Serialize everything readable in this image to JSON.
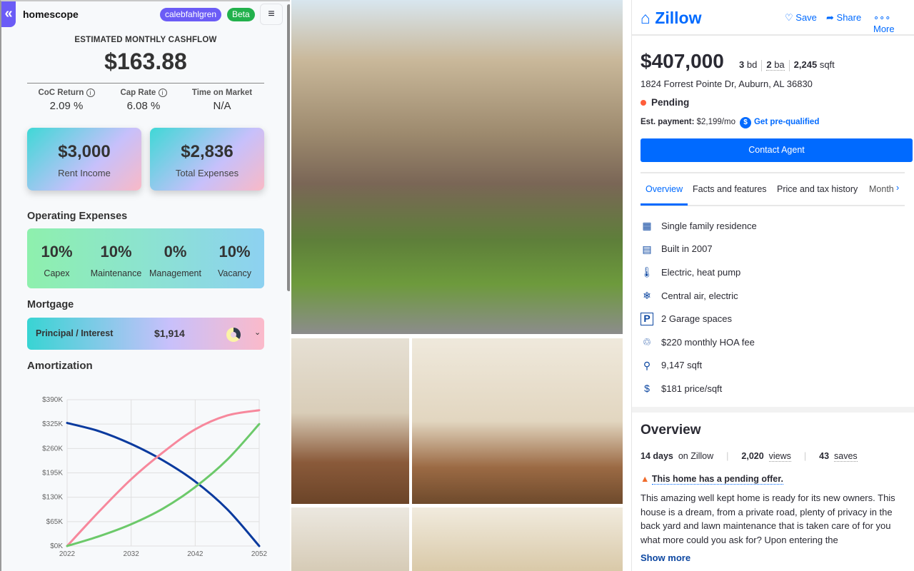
{
  "ext": {
    "brand": "homescope",
    "user": "calebfahlgren",
    "beta": "Beta",
    "cashflow_label": "ESTIMATED MONTHLY CASHFLOW",
    "cashflow": "$163.88",
    "stats": [
      {
        "label": "CoC Return",
        "value": "2.09 %",
        "info": true
      },
      {
        "label": "Cap Rate",
        "value": "6.08 %",
        "info": true
      },
      {
        "label": "Time on Market",
        "value": "N/A",
        "info": false
      }
    ],
    "cards": [
      {
        "value": "$3,000",
        "label": "Rent Income"
      },
      {
        "value": "$2,836",
        "label": "Total Expenses"
      }
    ],
    "opex_title": "Operating Expenses",
    "opex": [
      {
        "value": "10%",
        "label": "Capex"
      },
      {
        "value": "10%",
        "label": "Maintenance"
      },
      {
        "value": "0%",
        "label": "Management"
      },
      {
        "value": "10%",
        "label": "Vacancy"
      }
    ],
    "mortgage_title": "Mortgage",
    "mortgage_label": "Principal / Interest",
    "mortgage_value": "$1,914",
    "amort_title": "Amortization",
    "colors": {
      "accent": "#6b5cf6",
      "beta": "#22b14c"
    }
  },
  "chart_data": {
    "type": "line",
    "title": "",
    "xlabel": "",
    "ylabel": "",
    "x": [
      2022,
      2027,
      2032,
      2037,
      2042,
      2047,
      2052
    ],
    "xticks": [
      "2022",
      "2032",
      "2042",
      "2052"
    ],
    "yticks": [
      "$0K",
      "$65K",
      "$130K",
      "$195K",
      "$260K",
      "$325K",
      "$390K"
    ],
    "ylim": [
      0,
      390
    ],
    "grid": true,
    "series": [
      {
        "color": "#0a3a9e",
        "values": [
          328,
          306,
          272,
          228,
          172,
          98,
          0
        ]
      },
      {
        "color": "#f7889c",
        "values": [
          0,
          92,
          178,
          250,
          311,
          348,
          362
        ]
      },
      {
        "color": "#6cc96a",
        "values": [
          0,
          26,
          58,
          100,
          157,
          230,
          325
        ]
      }
    ]
  },
  "zillow": {
    "logo": "Zillow",
    "save": "Save",
    "share": "Share",
    "more": "More",
    "price": "$407,000",
    "beds": "3",
    "beds_u": "bd",
    "baths": "2",
    "baths_u": "ba",
    "sqft": "2,245",
    "sqft_u": "sqft",
    "address": "1824 Forrest Pointe Dr, Auburn, AL 36830",
    "status": "Pending",
    "est_label": "Est. payment:",
    "est_value": "$2,199/mo",
    "prequal": "Get pre-qualified",
    "contact": "Contact Agent",
    "tabs": [
      "Overview",
      "Facts and features",
      "Price and tax history",
      "Month"
    ],
    "facts": [
      {
        "icon": "building-icon",
        "glyph": "▦",
        "text": "Single family residence"
      },
      {
        "icon": "calendar-icon",
        "glyph": "▤",
        "text": "Built in 2007"
      },
      {
        "icon": "thermometer-icon",
        "glyph": "🌡",
        "text": "Electric, heat pump"
      },
      {
        "icon": "snowflake-icon",
        "glyph": "❄",
        "text": "Central air, electric"
      },
      {
        "icon": "parking-icon",
        "glyph": "P",
        "text": "2 Garage spaces"
      },
      {
        "icon": "hoa-hands-icon",
        "glyph": "♲",
        "text": "$220 monthly HOA fee"
      },
      {
        "icon": "lot-icon",
        "glyph": "⚲",
        "text": "9,147 sqft"
      },
      {
        "icon": "price-sqft-icon",
        "glyph": "$",
        "text": "$181 price/sqft"
      }
    ],
    "overview_title": "Overview",
    "days": "14 days",
    "days_u": "on Zillow",
    "views": "2,020",
    "views_u": "views",
    "saves": "43",
    "saves_u": "saves",
    "pending_offer": "This home has a pending offer.",
    "description": "This amazing well kept home is ready for its new owners. This house is a dream, from a private road, plenty of privacy in the back yard and lawn maintenance that is taken care of for you what more could you ask for? Upon entering the",
    "show_more": "Show more",
    "colors": {
      "brand": "#006aff",
      "pending": "#ff5e3a"
    }
  }
}
